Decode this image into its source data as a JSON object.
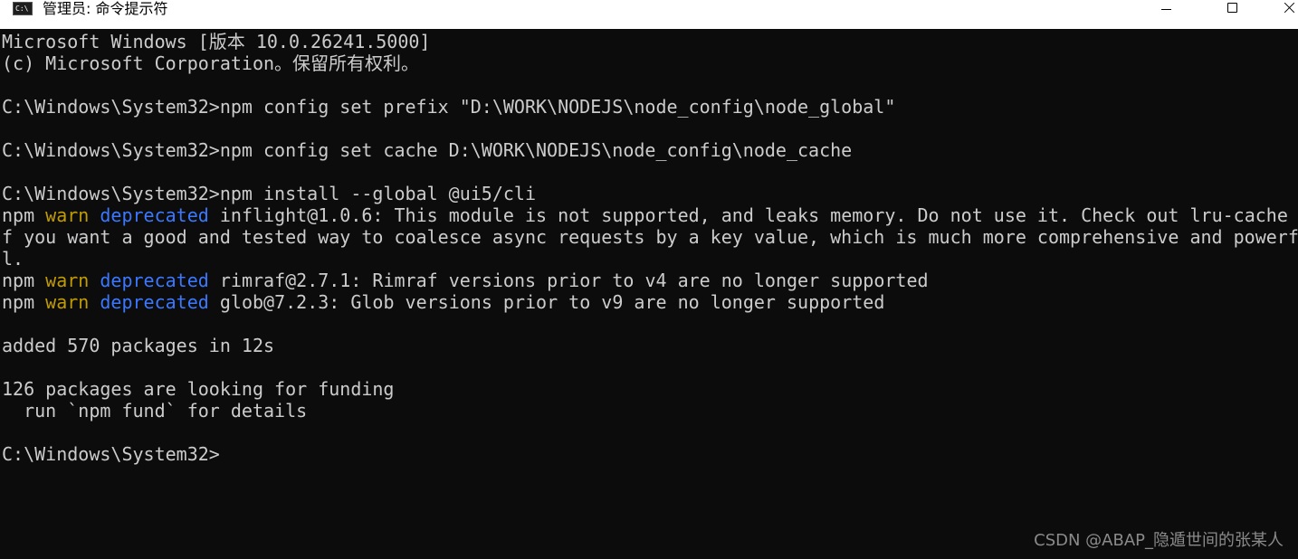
{
  "titlebar": {
    "title": "管理员: 命令提示符",
    "icon_label": "C:\\",
    "minimize": "minimize",
    "maximize": "maximize",
    "close": "close"
  },
  "console": {
    "header_line1": "Microsoft Windows [版本 10.0.26241.5000]",
    "header_line2": "(c) Microsoft Corporation。保留所有权利。",
    "cmd1": "C:\\Windows\\System32>npm config set prefix \"D:\\WORK\\NODEJS\\node_config\\node_global\"",
    "cmd2": "C:\\Windows\\System32>npm config set cache D:\\WORK\\NODEJS\\node_config\\node_cache",
    "cmd3": "C:\\Windows\\System32>npm install --global @ui5/cli",
    "npm": "npm",
    "warn": "warn",
    "deprecated": "deprecated",
    "warn1_text": "inflight@1.0.6: This module is not supported, and leaks memory. Do not use it. Check out lru-cache i",
    "warn1_cont1": "f you want a good and tested way to coalesce async requests by a key value, which is much more comprehensive and powerfu",
    "warn1_cont2": "l.",
    "warn2_text": "rimraf@2.7.1: Rimraf versions prior to v4 are no longer supported",
    "warn3_text": "glob@7.2.3: Glob versions prior to v9 are no longer supported",
    "added": "added 570 packages in 12s",
    "funding1": "126 packages are looking for funding",
    "funding2": "  run `npm fund` for details",
    "prompt": "C:\\Windows\\System32>"
  },
  "watermark": "CSDN @ABAP_隐遁世间的张某人"
}
